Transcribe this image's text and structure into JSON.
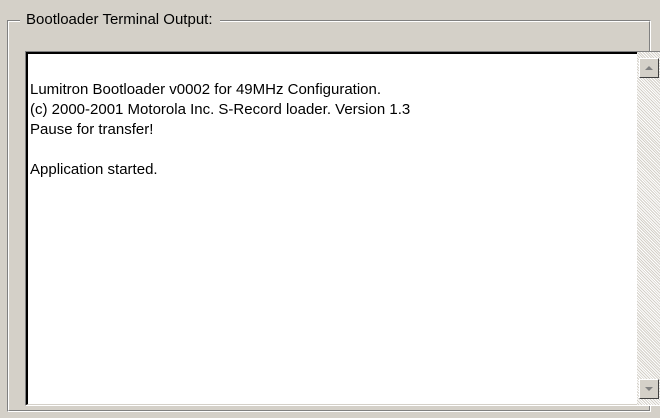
{
  "group": {
    "title": "Bootloader Terminal Output:"
  },
  "terminal": {
    "lines": [
      "Lumitron Bootloader v0002 for 49MHz Configuration.",
      "(c) 2000-2001 Motorola Inc. S-Record loader. Version 1.3",
      "Pause for transfer!",
      "",
      "Application started."
    ]
  },
  "scrollbar": {
    "up_icon": "scroll-up-arrow",
    "down_icon": "scroll-down-arrow"
  }
}
